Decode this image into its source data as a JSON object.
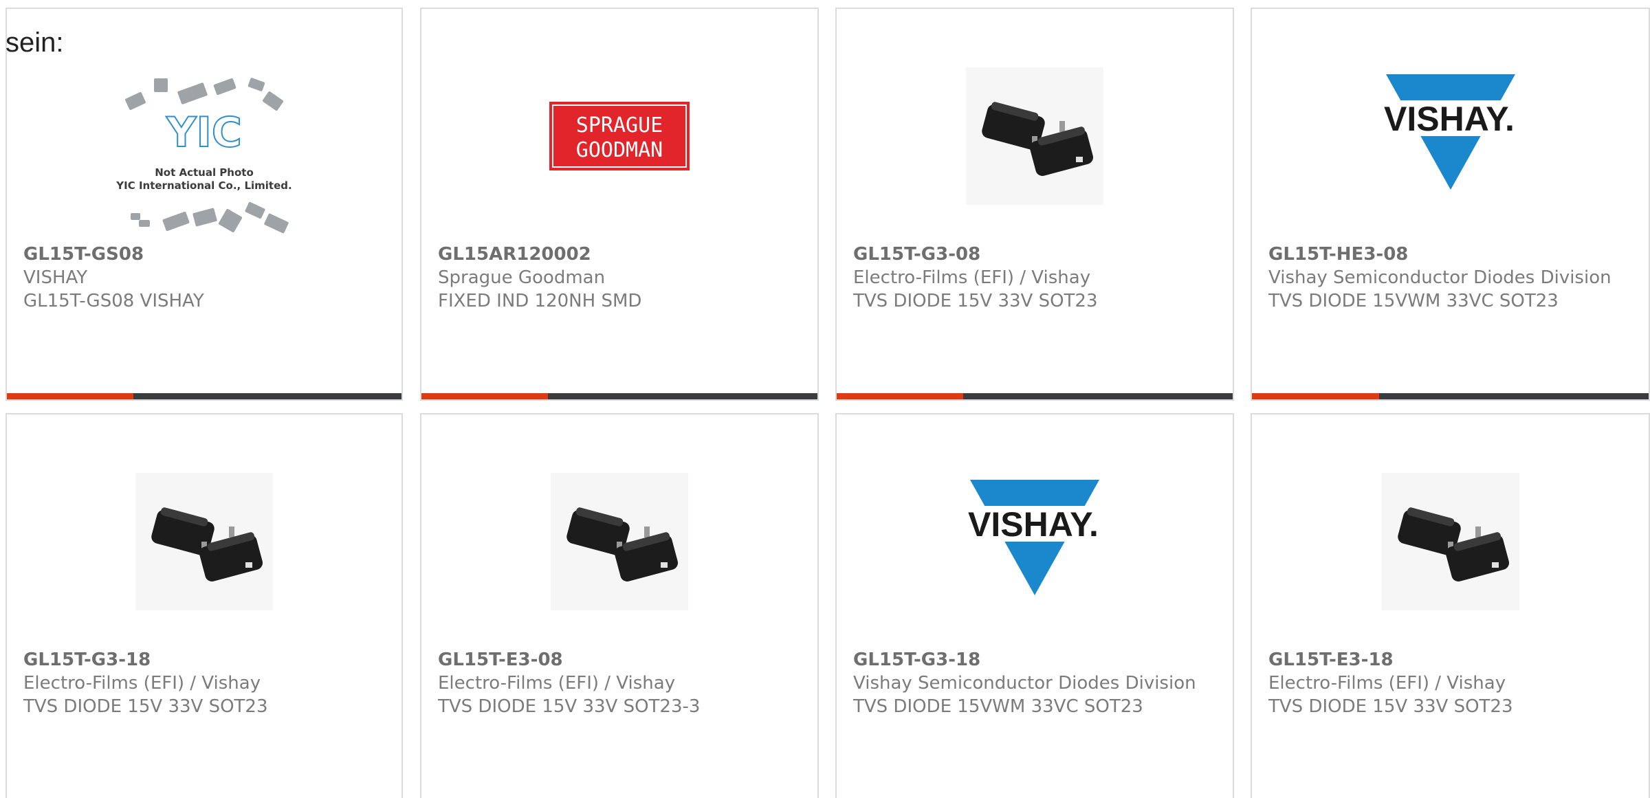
{
  "lead_text": "sein:",
  "colors": {
    "accent_orange": "#e03a12",
    "accent_dark": "#3a3d40",
    "vishay_blue": "#1b87cc",
    "sprague_red": "#e2252b"
  },
  "products": [
    {
      "part_number": "GL15T-GS08",
      "manufacturer": "VISHAY",
      "description": "GL15T-GS08 VISHAY",
      "image": "not-actual-photo",
      "image_caption_1": "Not Actual Photo",
      "image_caption_2": "YIC International Co., Limited.",
      "image_logo": "YIC"
    },
    {
      "part_number": "GL15AR120002",
      "manufacturer": "Sprague Goodman",
      "description": "FIXED IND 120NH SMD",
      "image": "sprague-goodman-logo",
      "logo_line_1": "SPRAGUE",
      "logo_line_2": "GOODMAN"
    },
    {
      "part_number": "GL15T-G3-08",
      "manufacturer": "Electro-Films (EFI) / Vishay",
      "description": "TVS DIODE 15V 33V SOT23",
      "image": "sot23-chip"
    },
    {
      "part_number": "GL15T-HE3-08",
      "manufacturer": "Vishay Semiconductor Diodes Division",
      "description": "TVS DIODE 15VWM 33VC SOT23",
      "image": "vishay-logo",
      "logo_text": "VISHAY."
    },
    {
      "part_number": "GL15T-G3-18",
      "manufacturer": "Electro-Films (EFI) / Vishay",
      "description": "TVS DIODE 15V 33V SOT23",
      "image": "sot23-chip"
    },
    {
      "part_number": "GL15T-E3-08",
      "manufacturer": "Electro-Films (EFI) / Vishay",
      "description": "TVS DIODE 15V 33V SOT23-3",
      "image": "sot23-chip"
    },
    {
      "part_number": "GL15T-G3-18",
      "manufacturer": "Vishay Semiconductor Diodes Division",
      "description": "TVS DIODE 15VWM 33VC SOT23",
      "image": "vishay-logo",
      "logo_text": "VISHAY."
    },
    {
      "part_number": "GL15T-E3-18",
      "manufacturer": "Electro-Films (EFI) / Vishay",
      "description": "TVS DIODE 15V 33V SOT23",
      "image": "sot23-chip"
    }
  ]
}
